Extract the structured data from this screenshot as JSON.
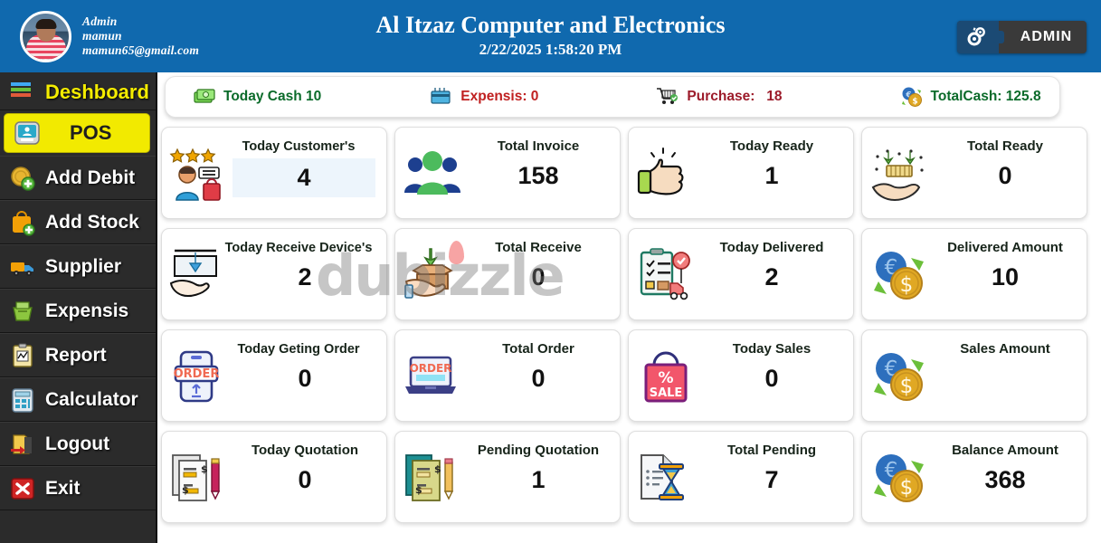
{
  "header": {
    "user": {
      "role": "Admin",
      "name": "mamun",
      "email": "mamun65@gmail.com"
    },
    "title": "Al Itzaz Computer and Electronics",
    "datetime": "2/22/2025 1:58:20 PM",
    "admin_button_label": "ADMIN",
    "admin_button_icon": "gears-puzzle-icon",
    "background_color": "#1069ae"
  },
  "sidebar": {
    "background_color": "#2b2b2b",
    "active_color": "#f2ea00",
    "items": [
      {
        "label": "Deshboard",
        "icon": "dashboard-bars-icon",
        "active": false,
        "style": "dash"
      },
      {
        "label": "POS",
        "icon": "pos-monitor-icon",
        "active": true,
        "style": "active"
      },
      {
        "label": "Add Debit",
        "icon": "coin-plus-icon",
        "active": false,
        "style": "normal"
      },
      {
        "label": "Add Stock",
        "icon": "shopping-bag-plus-icon",
        "active": false,
        "style": "normal"
      },
      {
        "label": "Supplier",
        "icon": "delivery-truck-icon",
        "active": false,
        "style": "normal"
      },
      {
        "label": "Expensis",
        "icon": "money-basket-icon",
        "active": false,
        "style": "normal"
      },
      {
        "label": "Report",
        "icon": "clipboard-report-icon",
        "active": false,
        "style": "normal"
      },
      {
        "label": "Calculator",
        "icon": "calculator-icon",
        "active": false,
        "style": "normal"
      },
      {
        "label": "Logout",
        "icon": "logout-arrow-icon",
        "active": false,
        "style": "normal"
      },
      {
        "label": "Exit",
        "icon": "red-x-icon",
        "active": false,
        "style": "normal"
      }
    ]
  },
  "status_strip": [
    {
      "label": "Today Cash",
      "value": "10",
      "text": "Today Cash 10",
      "color": "#0b6b2a",
      "icon": "cash-bundle-icon"
    },
    {
      "label": "Expensis:",
      "value": "0",
      "text": "Expensis: 0",
      "color": "#c02020",
      "icon": "expense-card-icon"
    },
    {
      "label": "Purchase:",
      "value": "18",
      "text": "Purchase:   18",
      "color": "#9c1b2a",
      "icon": "purchase-cart-icon"
    },
    {
      "label": "TotalCash:",
      "value": "125.8",
      "text": "TotalCash: 125.8",
      "color": "#0b6b2a",
      "icon": "coins-exchange-icon"
    }
  ],
  "cards": [
    {
      "title": "Today Customer's",
      "value": "4",
      "icon": "customer-stars-icon",
      "highlight": true
    },
    {
      "title": "Total Invoice",
      "value": "158",
      "icon": "people-group-icon",
      "highlight": false
    },
    {
      "title": "Today Ready",
      "value": "1",
      "icon": "thumbs-up-icon",
      "highlight": false
    },
    {
      "title": "Total Ready",
      "value": "0",
      "icon": "hand-package-icon",
      "highlight": false
    },
    {
      "title": "Today Receive Device's",
      "value": "2",
      "icon": "receive-device-icon",
      "highlight": false
    },
    {
      "title": "Total Receive",
      "value": "0",
      "icon": "open-box-hand-icon",
      "highlight": false
    },
    {
      "title": "Today Delivered",
      "value": "2",
      "icon": "delivery-checklist-icon",
      "highlight": false
    },
    {
      "title": "Delivered Amount",
      "value": "10",
      "icon": "coins-exchange-icon",
      "highlight": false
    },
    {
      "title": "Today Geting Order",
      "value": "0",
      "icon": "order-phone-icon",
      "highlight": false
    },
    {
      "title": "Total Order",
      "value": "0",
      "icon": "order-laptop-icon",
      "highlight": false
    },
    {
      "title": "Today Sales",
      "value": "0",
      "icon": "sale-bag-icon",
      "highlight": false
    },
    {
      "title": "Sales Amount",
      "value": "",
      "icon": "coins-exchange-icon",
      "highlight": false
    },
    {
      "title": "Today Quotation",
      "value": "0",
      "icon": "quotation-papers-icon",
      "highlight": false
    },
    {
      "title": "Pending Quotation",
      "value": "1",
      "icon": "quotation-pencil-icon",
      "highlight": false
    },
    {
      "title": "Total Pending",
      "value": "7",
      "icon": "hourglass-doc-icon",
      "highlight": false
    },
    {
      "title": "Balance Amount",
      "value": "368",
      "icon": "coins-exchange-icon",
      "highlight": false
    }
  ],
  "watermark": {
    "text": "dubizzle"
  }
}
